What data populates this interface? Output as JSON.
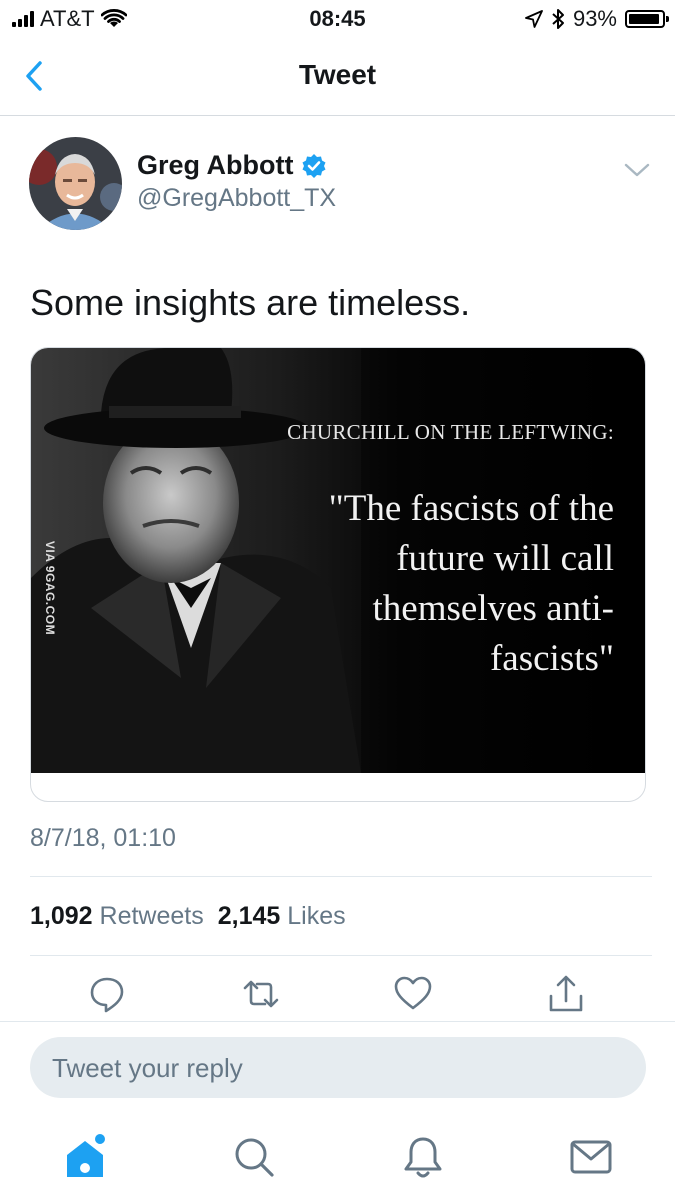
{
  "status_bar": {
    "carrier": "AT&T",
    "time": "08:45",
    "battery": "93%"
  },
  "nav": {
    "title": "Tweet"
  },
  "tweet": {
    "author_name": "Greg Abbott",
    "author_handle": "@GregAbbott_TX",
    "verified": true,
    "text": "Some insights are timeless.",
    "image": {
      "caption": "CHURCHILL ON THE LEFTWING:",
      "quote": "\"The fascists of the future will call themselves anti-fascists\"",
      "watermark": "VIA 9GAG.COM"
    },
    "timestamp": "8/7/18, 01:10",
    "retweets_count": "1,092",
    "retweets_label": "Retweets",
    "likes_count": "2,145",
    "likes_label": "Likes"
  },
  "actions": {
    "icons": [
      "reply-icon",
      "retweet-icon",
      "like-icon",
      "share-icon"
    ]
  },
  "reply": {
    "placeholder": "Tweet your reply"
  },
  "tab_bar": {
    "icons": [
      "home-icon",
      "search-icon",
      "notifications-icon",
      "messages-icon"
    ]
  },
  "colors": {
    "accent": "#1da1f2",
    "secondary_text": "#657786",
    "primary_text": "#14171a",
    "divider": "#e1e8ed",
    "reply_box_bg": "#e6ecf0"
  }
}
